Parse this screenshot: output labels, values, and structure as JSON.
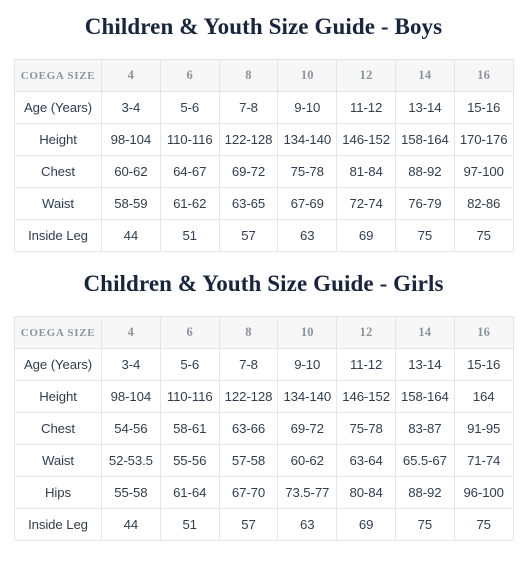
{
  "accent_colors": {
    "title": "#17253f",
    "header_bg": "#f7f7f8",
    "header_text": "#8d939c",
    "body_text": "#2f3e4e",
    "border": "#e4e6e8",
    "page_bg": "#ffffff"
  },
  "sections": [
    {
      "title": "Children & Youth Size Guide - Boys",
      "table": {
        "label_header": "COEGA SIZE",
        "size_headers": [
          "4",
          "6",
          "8",
          "10",
          "12",
          "14",
          "16"
        ],
        "rows": [
          {
            "label": "Age (Years)",
            "values": [
              "3-4",
              "5-6",
              "7-8",
              "9-10",
              "11-12",
              "13-14",
              "15-16"
            ]
          },
          {
            "label": "Height",
            "values": [
              "98-104",
              "110-116",
              "122-128",
              "134-140",
              "146-152",
              "158-164",
              "170-176"
            ]
          },
          {
            "label": "Chest",
            "values": [
              "60-62",
              "64-67",
              "69-72",
              "75-78",
              "81-84",
              "88-92",
              "97-100"
            ]
          },
          {
            "label": "Waist",
            "values": [
              "58-59",
              "61-62",
              "63-65",
              "67-69",
              "72-74",
              "76-79",
              "82-86"
            ]
          },
          {
            "label": "Inside Leg",
            "values": [
              "44",
              "51",
              "57",
              "63",
              "69",
              "75",
              "75"
            ]
          }
        ]
      }
    },
    {
      "title": "Children & Youth Size Guide - Girls",
      "table": {
        "label_header": "COEGA SIZE",
        "size_headers": [
          "4",
          "6",
          "8",
          "10",
          "12",
          "14",
          "16"
        ],
        "rows": [
          {
            "label": "Age (Years)",
            "values": [
              "3-4",
              "5-6",
              "7-8",
              "9-10",
              "11-12",
              "13-14",
              "15-16"
            ]
          },
          {
            "label": "Height",
            "values": [
              "98-104",
              "110-116",
              "122-128",
              "134-140",
              "146-152",
              "158-164",
              "164"
            ]
          },
          {
            "label": "Chest",
            "values": [
              "54-56",
              "58-61",
              "63-66",
              "69-72",
              "75-78",
              "83-87",
              "91-95"
            ]
          },
          {
            "label": "Waist",
            "values": [
              "52-53.5",
              "55-56",
              "57-58",
              "60-62",
              "63-64",
              "65.5-67",
              "71-74"
            ]
          },
          {
            "label": "Hips",
            "values": [
              "55-58",
              "61-64",
              "67-70",
              "73.5-77",
              "80-84",
              "88-92",
              "96-100"
            ]
          },
          {
            "label": "Inside Leg",
            "values": [
              "44",
              "51",
              "57",
              "63",
              "69",
              "75",
              "75"
            ]
          }
        ]
      }
    }
  ]
}
